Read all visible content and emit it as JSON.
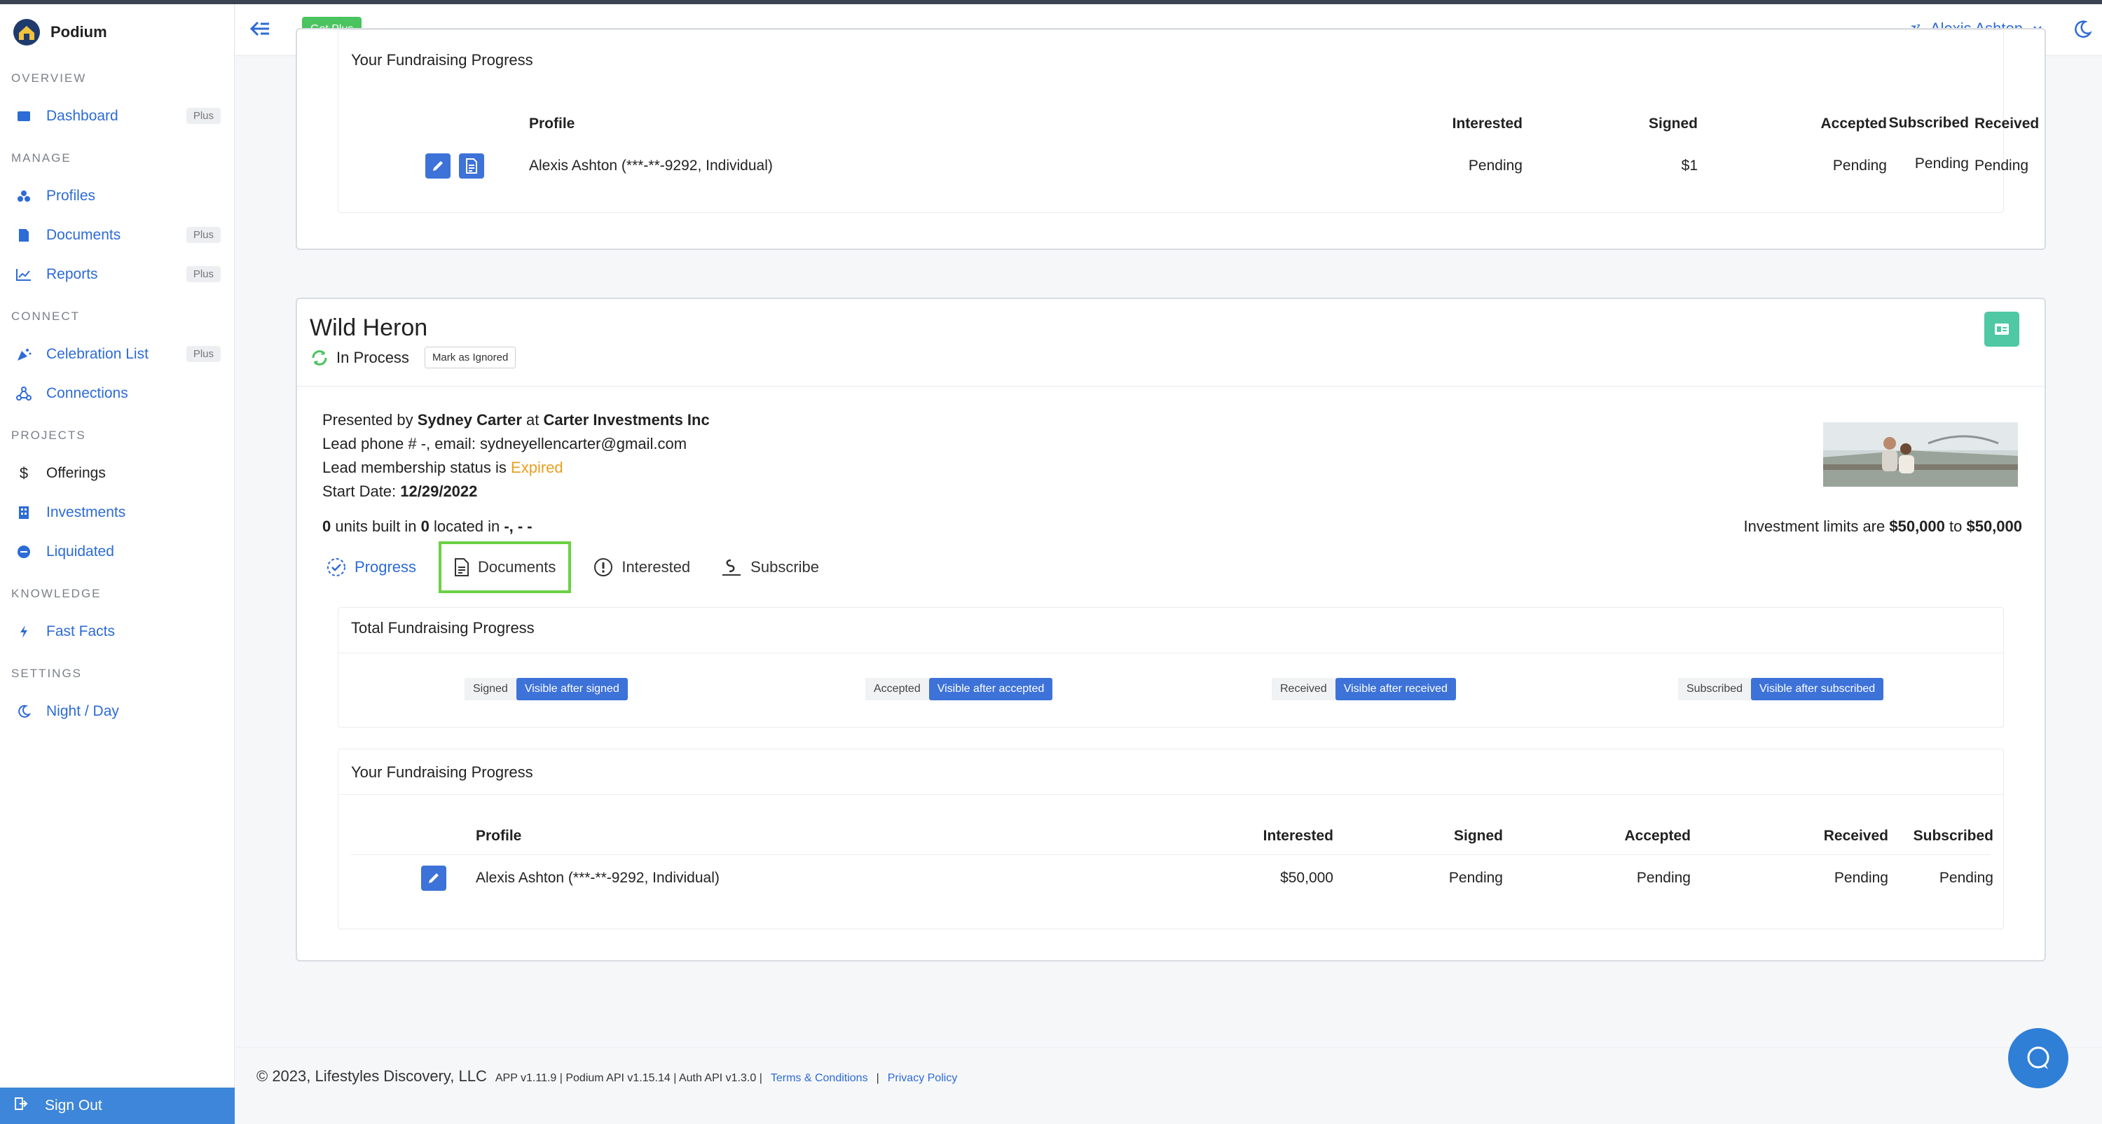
{
  "app": {
    "name": "Podium"
  },
  "header": {
    "get_plus": "Get Plus",
    "user_name": "Alexis Ashton"
  },
  "sidebar": {
    "sections": [
      {
        "title": "OVERVIEW"
      },
      {
        "title": "MANAGE"
      },
      {
        "title": "CONNECT"
      },
      {
        "title": "PROJECTS"
      },
      {
        "title": "KNOWLEDGE"
      },
      {
        "title": "SETTINGS"
      }
    ],
    "items": {
      "dashboard": {
        "label": "Dashboard",
        "tag": "Plus"
      },
      "profiles": {
        "label": "Profiles"
      },
      "documents": {
        "label": "Documents",
        "tag": "Plus"
      },
      "reports": {
        "label": "Reports",
        "tag": "Plus"
      },
      "celebration": {
        "label": "Celebration List",
        "tag": "Plus"
      },
      "connections": {
        "label": "Connections"
      },
      "offerings": {
        "label": "Offerings"
      },
      "investments": {
        "label": "Investments"
      },
      "liquidated": {
        "label": "Liquidated"
      },
      "fastfacts": {
        "label": "Fast Facts"
      },
      "nightday": {
        "label": "Night / Day"
      }
    },
    "signout": "Sign Out"
  },
  "top_card": {
    "title": "Your Fundraising Progress",
    "headers": [
      "Profile",
      "Interested",
      "Signed",
      "Accepted",
      "Received",
      "Subscribed"
    ],
    "row": [
      "Alexis Ashton (***-**-9292, Individual)",
      "Pending",
      "$1",
      "Pending",
      "Pending",
      "Pending"
    ]
  },
  "offering": {
    "name": "Wild Heron",
    "status": "In Process",
    "mark_ignored": "Mark as Ignored",
    "presented_prefix": "Presented by ",
    "presenter": "Sydney Carter",
    "at": " at ",
    "company": "Carter Investments Inc",
    "phone_prefix": "Lead phone # -, email: ",
    "email": "sydneyellencarter@gmail.com",
    "membership_prefix": "Lead membership status is ",
    "membership_status": "Expired",
    "start_prefix": "Start Date: ",
    "start_date": "12/29/2022",
    "units_a": "0",
    "units_mid": " units built in ",
    "units_b": "0",
    "units_located": " located in ",
    "units_loc": "-, - -",
    "limits_prefix": "Investment limits are ",
    "limit_min": "$50,000",
    "limit_to": " to ",
    "limit_max": "$50,000",
    "tabs": [
      "Progress",
      "Documents",
      "Interested",
      "Subscribe"
    ],
    "total_title": "Total Fundraising Progress",
    "pills": [
      {
        "key": "Signed",
        "value": "Visible after signed"
      },
      {
        "key": "Accepted",
        "value": "Visible after accepted"
      },
      {
        "key": "Received",
        "value": "Visible after received"
      },
      {
        "key": "Subscribed",
        "value": "Visible after subscribed"
      }
    ],
    "your_title": "Your Fundraising Progress",
    "headers": [
      "Profile",
      "Interested",
      "Signed",
      "Accepted",
      "Received",
      "Subscribed"
    ],
    "row": [
      "Alexis Ashton (***-**-9292, Individual)",
      "$50,000",
      "Pending",
      "Pending",
      "Pending",
      "Pending"
    ]
  },
  "footer": {
    "copyright": "© 2023, Lifestyles Discovery, LLC",
    "versions": "APP v1.11.9 | Podium API v1.15.14 | Auth API v1.3.0 |",
    "terms": "Terms & Conditions",
    "sep": "|",
    "privacy": "Privacy Policy"
  },
  "colors": {
    "accent": "#2d6bd6",
    "green": "#4bc35f",
    "selection": "#6bd144",
    "expired": "#e9a021"
  }
}
